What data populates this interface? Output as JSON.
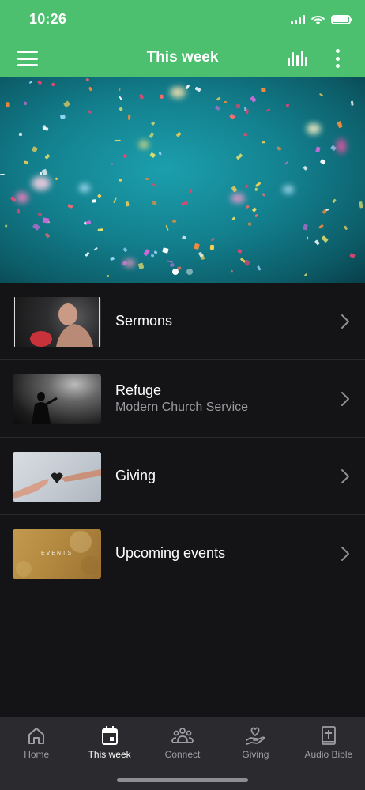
{
  "status_bar": {
    "time": "10:26"
  },
  "header": {
    "title": "This week"
  },
  "carousel": {
    "page_count": 2,
    "active_index": 0
  },
  "list": {
    "items": [
      {
        "title": "Sermons",
        "subtitle": ""
      },
      {
        "title": "Refuge",
        "subtitle": "Modern Church Service"
      },
      {
        "title": "Giving",
        "subtitle": ""
      },
      {
        "title": "Upcoming events",
        "subtitle": "",
        "thumb_text": "EVENTS"
      }
    ]
  },
  "bottom_nav": {
    "items": [
      {
        "label": "Home",
        "icon": "home-icon"
      },
      {
        "label": "This week",
        "icon": "calendar-icon",
        "active": true
      },
      {
        "label": "Connect",
        "icon": "people-group-icon"
      },
      {
        "label": "Giving",
        "icon": "hand-heart-icon"
      },
      {
        "label": "Audio Bible",
        "icon": "bible-icon"
      }
    ]
  },
  "colors": {
    "header_bg": "#4cc06e",
    "page_bg": "#141416",
    "nav_bg": "#2b2b2f",
    "nav_active": "#ffffff",
    "nav_inactive": "#9d9da3",
    "subtitle": "#9a9aa0"
  }
}
